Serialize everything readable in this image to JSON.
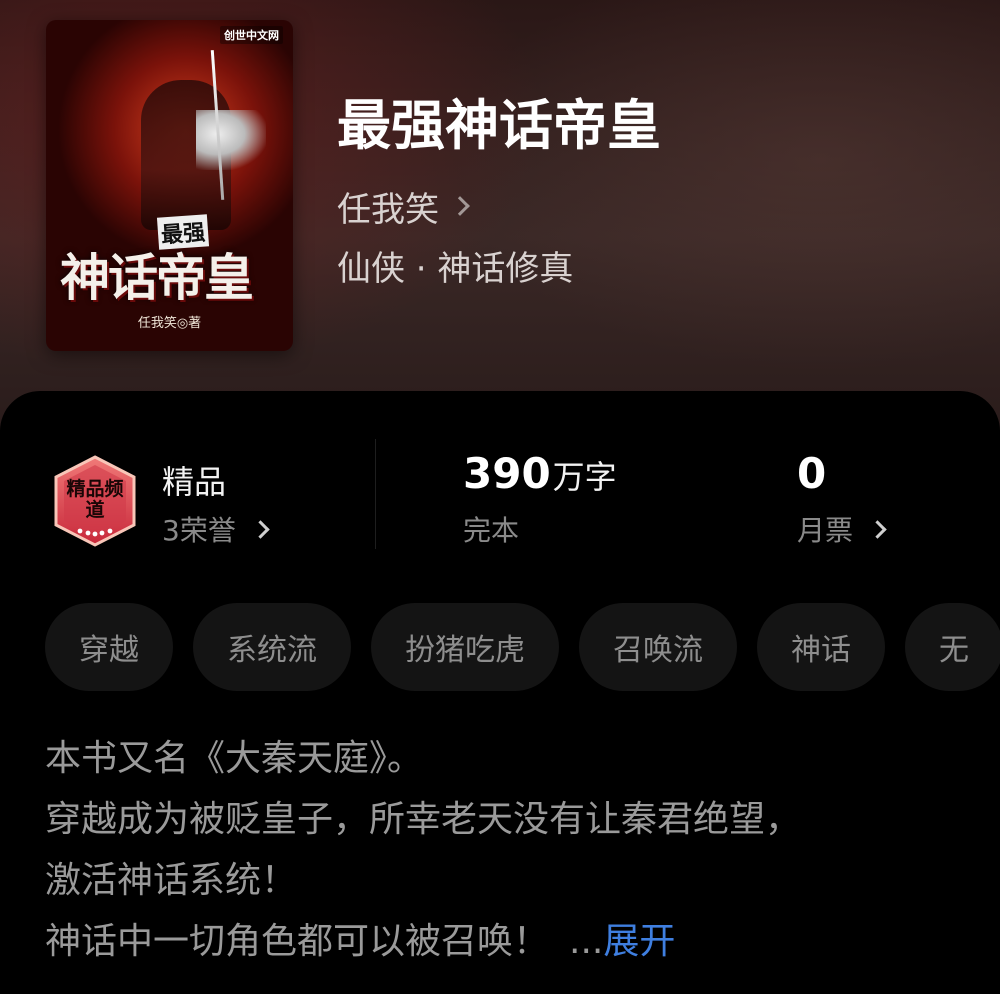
{
  "book": {
    "title": "最强神话帝皇",
    "author": "任我笑",
    "genre": "仙侠 · 神话修真",
    "cover": {
      "publisher_mark": "创世中文网",
      "title_small": "最强",
      "title_big": "神话帝皇",
      "author_line": "任我笑◎著"
    }
  },
  "stats": {
    "badge_text": "精品频道",
    "category_label": "精品",
    "honors_label": "3荣誉",
    "word_count": "390",
    "word_unit": "万字",
    "status": "完本",
    "monthly_votes": "0",
    "monthly_votes_label": "月票"
  },
  "tags": [
    "穿越",
    "系统流",
    "扮猪吃虎",
    "召唤流",
    "神话",
    "无"
  ],
  "description": {
    "lines": [
      "本书又名《大秦天庭》。",
      "穿越成为被贬皇子，所幸老天没有让秦君绝望，",
      "激活神话系统！",
      "神话中一切角色都可以被召唤！"
    ],
    "ellipsis": "...",
    "expand_label": "展开"
  },
  "colors": {
    "accent_link": "#3f7fe0",
    "background": "#000000",
    "tag_background": "#141414"
  },
  "icons": {
    "author_arrow": "chevron-right-icon",
    "honors_arrow": "chevron-right-icon",
    "votes_arrow": "chevron-right-icon",
    "badge": "premium-channel-badge-icon"
  }
}
